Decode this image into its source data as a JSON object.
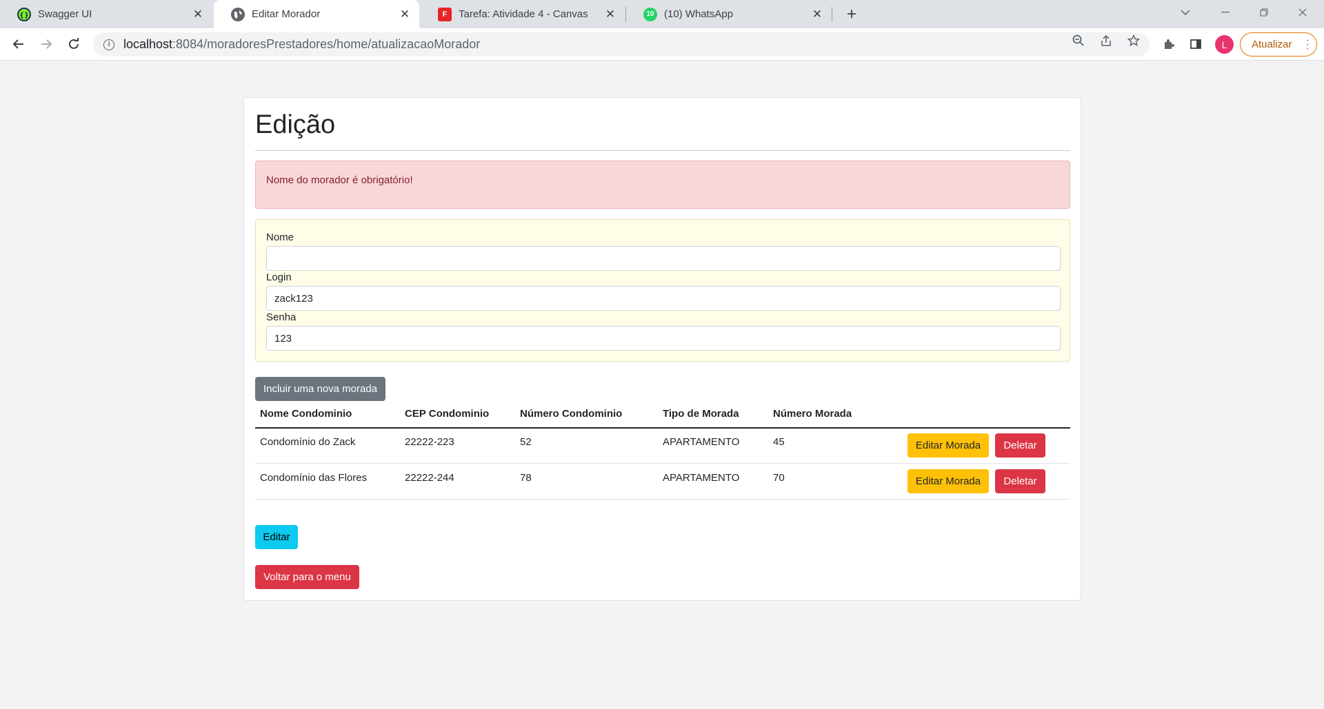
{
  "browser": {
    "tabs": [
      {
        "title": "Swagger UI",
        "icon": "swagger-icon"
      },
      {
        "title": "Editar Morador",
        "icon": "globe-icon"
      },
      {
        "title": "Tarefa: Atividade 4 - Canvas",
        "icon": "canvas-icon"
      },
      {
        "title": "(10) WhatsApp",
        "icon": "whatsapp-icon",
        "badge": "10"
      }
    ],
    "url_host": "localhost",
    "url_path": ":8084/moradoresPrestadores/home/atualizacaoMorador",
    "profile_initial": "L",
    "update_label": "Atualizar"
  },
  "page": {
    "title": "Edição",
    "alert": "Nome do morador é obrigatório!",
    "form": {
      "nome_label": "Nome",
      "nome_value": "",
      "login_label": "Login",
      "login_value": "zack123",
      "senha_label": "Senha",
      "senha_value": "123"
    },
    "add_button": "Incluir uma nova morada",
    "table": {
      "headers": [
        "Nome Condominio",
        "CEP Condominio",
        "Número Condominio",
        "Tipo de Morada",
        "Número Morada"
      ],
      "rows": [
        {
          "nome": "Condomínio do Zack",
          "cep": "22222-223",
          "numero_cond": "52",
          "tipo": "APARTAMENTO",
          "numero_morada": "45",
          "edit_label": "Editar Morada",
          "delete_label": "Deletar"
        },
        {
          "nome": "Condomínio das Flores",
          "cep": "22222-244",
          "numero_cond": "78",
          "tipo": "APARTAMENTO",
          "numero_morada": "70",
          "edit_label": "Editar Morada",
          "delete_label": "Deletar"
        }
      ]
    },
    "edit_button": "Editar",
    "back_button": "Voltar para o menu"
  },
  "colors": {
    "alert_bg": "#f8d7da",
    "form_bg": "#fffde8",
    "warning": "#ffc107",
    "danger": "#dc3545",
    "info": "#0dcaf0",
    "secondary": "#6c757d"
  }
}
